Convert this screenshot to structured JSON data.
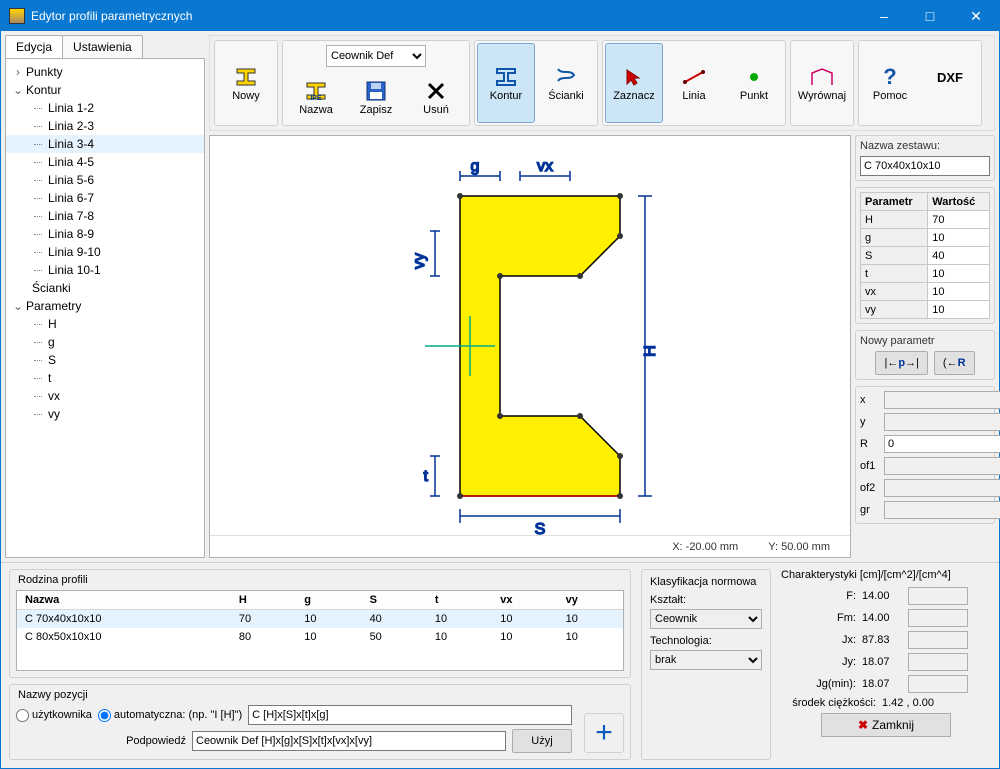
{
  "window": {
    "title": "Edytor profili parametrycznych"
  },
  "tabs": {
    "edit": "Edycja",
    "settings": "Ustawienia"
  },
  "tree": {
    "punkty": "Punkty",
    "kontur": "Kontur",
    "lines": [
      "Linia 1-2",
      "Linia 2-3",
      "Linia 3-4",
      "Linia 4-5",
      "Linia 5-6",
      "Linia 6-7",
      "Linia 7-8",
      "Linia 8-9",
      "Linia 9-10",
      "Linia 10-1"
    ],
    "selected_line_index": 2,
    "scianki": "Ścianki",
    "parametry": "Parametry",
    "params": [
      "H",
      "g",
      "S",
      "t",
      "vx",
      "vy"
    ]
  },
  "toolbar": {
    "nowy": "Nowy",
    "profile_select": "Ceownik Def",
    "nazwa": "Nazwa",
    "zapisz": "Zapisz",
    "usun": "Usuń",
    "kontur": "Kontur",
    "scianki": "Ścianki",
    "zaznacz": "Zaznacz",
    "linia": "Linia",
    "punkt": "Punkt",
    "wyrownaj": "Wyrównaj",
    "pomoc": "Pomoc",
    "dxf": "DXF"
  },
  "canvas": {
    "dims": {
      "g": "g",
      "vx": "vx",
      "vy": "vy",
      "t": "t",
      "S": "S",
      "H": "H"
    },
    "status": {
      "x": "X:  -20.00 mm",
      "y": "Y:   50.00 mm"
    }
  },
  "right": {
    "set_name_label": "Nazwa zestawu:",
    "set_name": "C 70x40x10x10",
    "param_header": {
      "p": "Parametr",
      "v": "Wartość"
    },
    "params": [
      {
        "p": "H",
        "v": "70"
      },
      {
        "p": "g",
        "v": "10"
      },
      {
        "p": "S",
        "v": "40"
      },
      {
        "p": "t",
        "v": "10"
      },
      {
        "p": "vx",
        "v": "10"
      },
      {
        "p": "vy",
        "v": "10"
      }
    ],
    "newparam_label": "Nowy parametr",
    "btn_p": "p",
    "btn_r": "R",
    "coords": {
      "x": "x",
      "y": "y",
      "R": "R",
      "R_val": "0",
      "of1": "of1",
      "of2": "of2",
      "gr": "gr"
    }
  },
  "lower": {
    "family_label": "Rodzina profili",
    "family_cols": [
      "Nazwa",
      "H",
      "g",
      "S",
      "t",
      "vx",
      "vy"
    ],
    "family_rows": [
      {
        "n": "C 70x40x10x10",
        "H": "70",
        "g": "10",
        "S": "40",
        "t": "10",
        "vx": "10",
        "vy": "10",
        "sel": true
      },
      {
        "n": "C 80x50x10x10",
        "H": "80",
        "g": "10",
        "S": "50",
        "t": "10",
        "vx": "10",
        "vy": "10"
      }
    ],
    "names_label": "Nazwy pozycji",
    "radio_user": "użytkownika",
    "radio_auto": "automatyczna: (np. \"I [H]\")",
    "name_pattern": "C [H]x[S]x[t]x[g]",
    "hint_label": "Podpowiedź",
    "hint_value": "Ceownik Def [H]x[g]x[S]x[t]x[vx]x[vy]",
    "use_btn": "Użyj",
    "klas_label": "Klasyfikacja normowa",
    "ksztalt_label": "Kształt:",
    "ksztalt_value": "Ceownik",
    "tech_label": "Technologia:",
    "tech_value": "brak",
    "char_title": "Charakterystyki [cm]/[cm^2]/[cm^4]",
    "chars": [
      {
        "k": "F:",
        "v": "14.00"
      },
      {
        "k": "Fm:",
        "v": "14.00"
      },
      {
        "k": "Jx:",
        "v": "87.83"
      },
      {
        "k": "Jy:",
        "v": "18.07"
      },
      {
        "k": "Jg(min):",
        "v": "18.07"
      }
    ],
    "cg_label": "środek ciężkości:",
    "cg_value": "1.42 , 0.00",
    "close": "Zamknij"
  }
}
